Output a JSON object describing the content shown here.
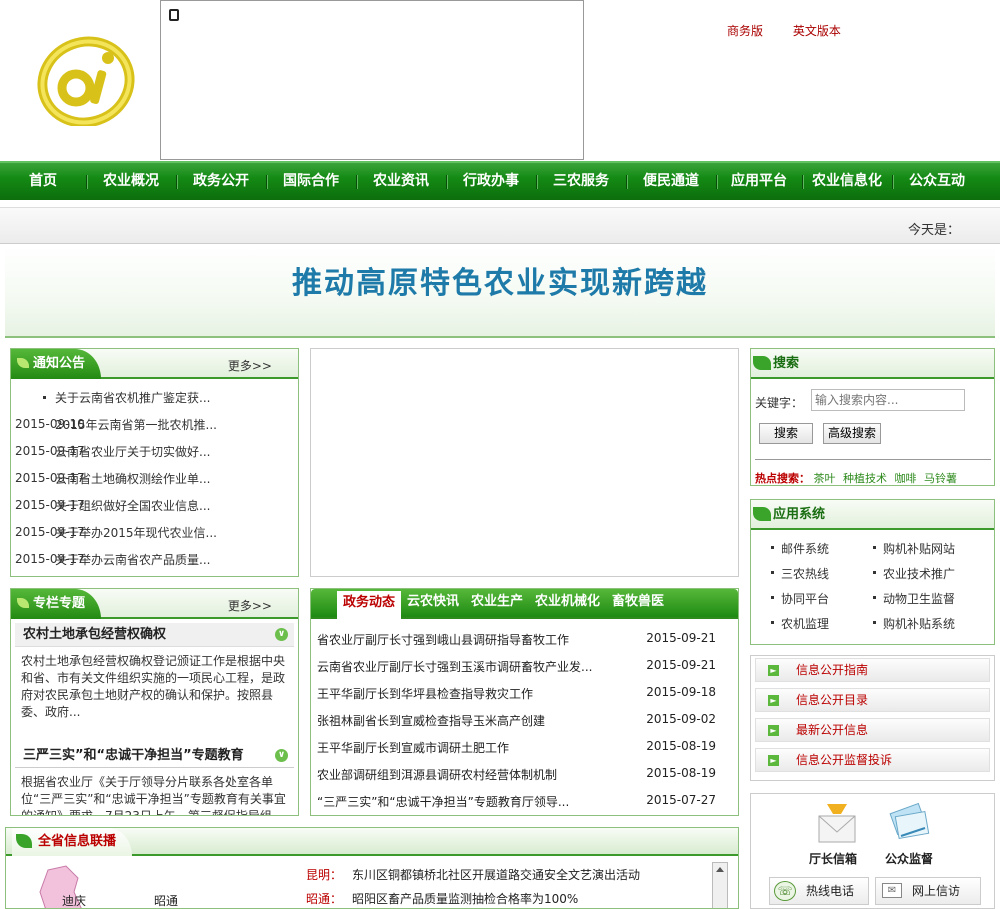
{
  "header": {
    "logo_text": "@",
    "top_links": [
      "商务版",
      "英文版本"
    ],
    "nav": [
      "首页",
      "农业概况",
      "政务公开",
      "国际合作",
      "农业资讯",
      "行政办事",
      "三农服务",
      "便民通道",
      "应用平台",
      "农业信息化",
      "公众互动"
    ],
    "today_label": "今天是："
  },
  "banner": {
    "slogan": "推动高原特色农业实现新跨越"
  },
  "notice": {
    "title": "通知公告",
    "more": "更多>>",
    "items": [
      {
        "title": "关于云南省农机推广鉴定获...",
        "date": "2015-09-10"
      },
      {
        "title": "2015年云南省第一批农机推...",
        "date": "2015-09-17"
      },
      {
        "title": "云南省农业厅关于切实做好...",
        "date": "2015-09-17"
      },
      {
        "title": "云南省土地确权测绘作业单...",
        "date": "2015-09-17"
      },
      {
        "title": "关于组织做好全国农业信息...",
        "date": "2015-09-17"
      },
      {
        "title": "关于举办2015年现代农业信...",
        "date": "2015-09-17"
      },
      {
        "title": "关于举办云南省农产品质量...",
        "date": "2015-09-17"
      }
    ]
  },
  "special": {
    "title": "专栏专题",
    "more": "更多>>",
    "topics": [
      {
        "title": "农村土地承包经营权确权",
        "body": "农村土地承包经营权确权登记颁证工作是根据中央和省、市有关文件组织实施的一项民心工程，是政府对农民承包土地财产权的确认和保护。按照县委、政府..."
      },
      {
        "title": "三严三实”和“忠诚干净担当”专题教育",
        "body": "根据省农业厅《关于厅领导分片联系各处室各单位“三严三实”和“忠诚干净担当”专题教育有关事宜的通知》要求，7月23日上午，第三督促指导组"
      }
    ]
  },
  "news": {
    "tabs": [
      "政务动态",
      "云农快讯",
      "农业生产",
      "农业机械化",
      "畜牧兽医"
    ],
    "active_tab": 0,
    "rows": [
      {
        "title": "省农业厅副厅长寸强到峨山县调研指导畜牧工作",
        "date": "2015-09-21"
      },
      {
        "title": "云南省农业厅副厅长寸强到玉溪市调研畜牧产业发...",
        "date": "2015-09-21"
      },
      {
        "title": "王平华副厅长到华坪县检查指导救灾工作",
        "date": "2015-09-18"
      },
      {
        "title": "张祖林副省长到宣威检查指导玉米高产创建",
        "date": "2015-09-02"
      },
      {
        "title": "王平华副厅长到宣威市调研土肥工作",
        "date": "2015-08-19"
      },
      {
        "title": "农业部调研组到洱源县调研农村经营体制机制",
        "date": "2015-08-19"
      },
      {
        "title": "“三严三实”和“忠诚干净担当”专题教育厅领导...",
        "date": "2015-07-27"
      }
    ]
  },
  "search": {
    "title": "搜索",
    "keyword_label": "关键字：",
    "placeholder": "输入搜索内容...",
    "search_btn": "搜索",
    "advanced_btn": "高级搜索",
    "hot_label": "热点搜索：",
    "hot_terms": [
      "茶叶",
      "种植技术",
      "咖啡",
      "马铃薯"
    ]
  },
  "apps": {
    "title": "应用系统",
    "items": [
      "邮件系统",
      "购机补贴网站",
      "三农热线",
      "农业技术推广",
      "协同平台",
      "动物卫生监督",
      "农机监理",
      "购机补贴系统"
    ]
  },
  "public_info": [
    "信息公开指南",
    "信息公开目录",
    "最新公开信息",
    "信息公开监督投诉"
  ],
  "mailbox": {
    "director_label": "厅长信箱",
    "supervise_label": "公众监督",
    "hotline_label": "热线电话",
    "letter_label": "网上信访"
  },
  "province": {
    "title": "全省信息联播",
    "map_labels": [
      "迪庆",
      "昭通"
    ],
    "rows": [
      {
        "city": "昆明：",
        "text": "东川区铜都镇桥北社区开展道路交通安全文艺演出活动"
      },
      {
        "city": "昭通：",
        "text": "昭阳区畜产品质量监测抽检合格率为100%"
      }
    ]
  },
  "colors": {
    "nav_green": "#148a14",
    "accent_red": "#b00000",
    "banner_blue": "#1e7aa8"
  }
}
